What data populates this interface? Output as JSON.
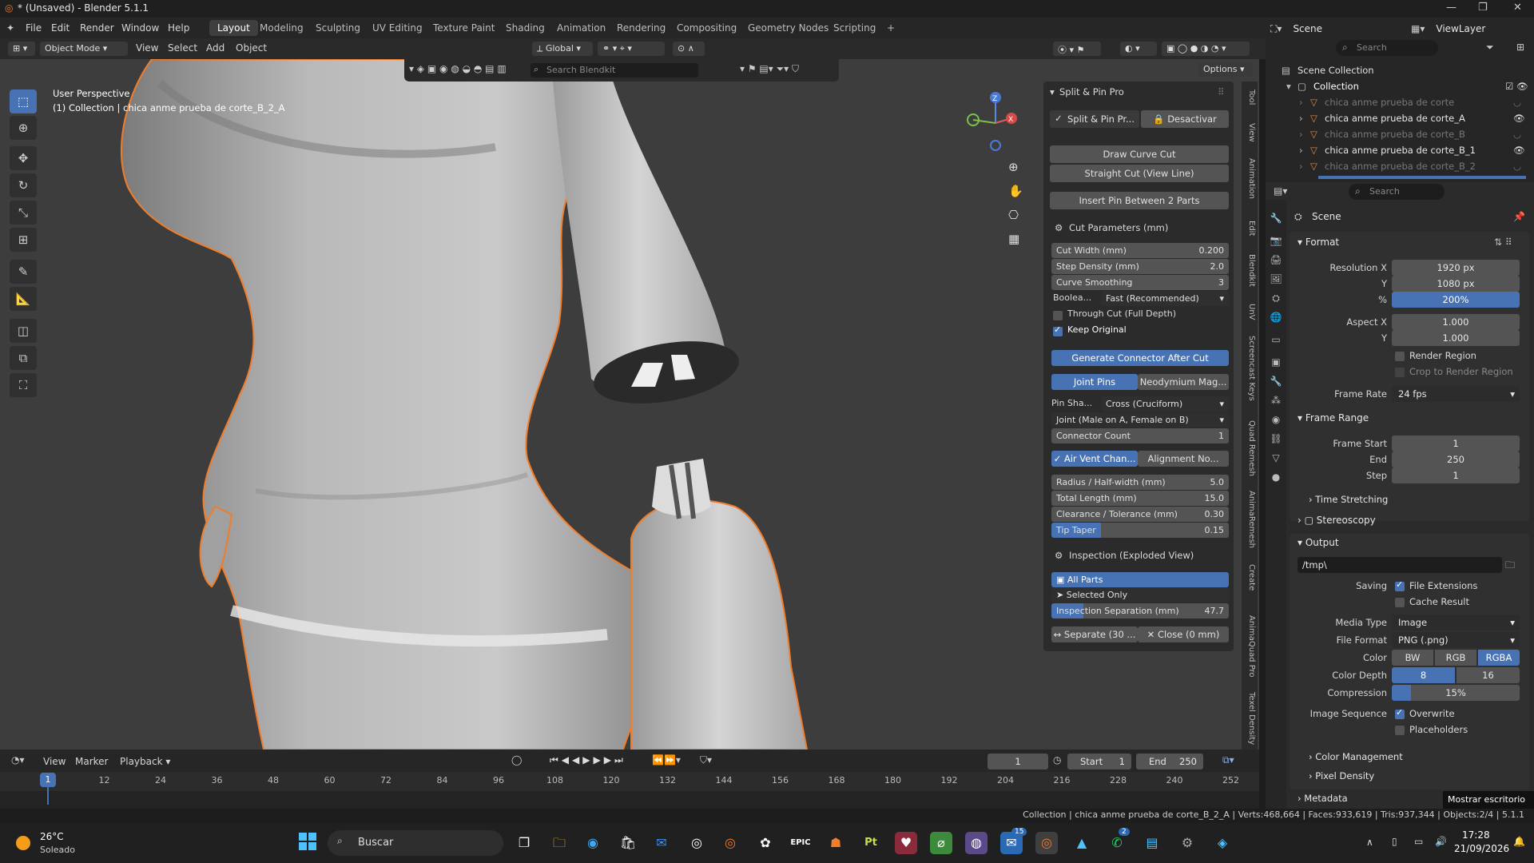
{
  "window": {
    "title": "* (Unsaved) - Blender 5.1.1",
    "controls": [
      "—",
      "❐",
      "✕"
    ]
  },
  "menu": [
    "File",
    "Edit",
    "Render",
    "Window",
    "Help"
  ],
  "workspaces": [
    "Layout",
    "Modeling",
    "Sculpting",
    "UV Editing",
    "Texture Paint",
    "Shading",
    "Animation",
    "Rendering",
    "Compositing",
    "Geometry Nodes",
    "Scripting",
    "+"
  ],
  "active_workspace": "Layout",
  "scene": {
    "label": "Scene",
    "view_layer": "ViewLayer"
  },
  "header": {
    "mode": "Object Mode",
    "view": "View",
    "select": "Select",
    "add": "Add",
    "object": "Object",
    "orientation": "Global",
    "options": "Options"
  },
  "blendkit": {
    "search_placeholder": "Search Blendkit"
  },
  "viewport": {
    "perspective": "User Perspective",
    "collection_line": "(1) Collection | chica anme prueba de corte_B_2_A"
  },
  "split_pin": {
    "title": "Split & Pin Pro",
    "addon_label": "Split & Pin Pr...",
    "deactivate": "Desactivar",
    "draw_curve_cut": "Draw Curve Cut",
    "straight_cut": "Straight Cut (View Line)",
    "insert_pin": "Insert Pin Between 2 Parts",
    "cut_params": "Cut Parameters (mm)",
    "cut_width": {
      "label": "Cut Width (mm)",
      "value": "0.200"
    },
    "step_density": {
      "label": "Step Density (mm)",
      "value": "2.0"
    },
    "curve_smoothing": {
      "label": "Curve Smoothing",
      "value": "3"
    },
    "boolean": {
      "label": "Boolea...",
      "value": "Fast (Recommended)"
    },
    "through_cut": "Through Cut (Full Depth)",
    "keep_original": "Keep Original",
    "generate_connector": "Generate Connector After Cut",
    "joint_pins": "Joint Pins",
    "neodymium": "Neodymium Mag...",
    "pin_shape": {
      "label": "Pin Sha...",
      "value": "Cross (Cruciform)"
    },
    "joint_type": "Joint (Male on A, Female on B)",
    "connector_count": {
      "label": "Connector Count",
      "value": "1"
    },
    "air_vent": "Air Vent Chan...",
    "alignment": "Alignment No...",
    "radius": {
      "label": "Radius / Half-width (mm)",
      "value": "5.0"
    },
    "total_length": {
      "label": "Total Length (mm)",
      "value": "15.0"
    },
    "clearance": {
      "label": "Clearance / Tolerance (mm)",
      "value": "0.30"
    },
    "tip_taper": {
      "label": "Tip Taper",
      "value": "0.15"
    },
    "inspection": "Inspection (Exploded View)",
    "all_parts": "All Parts",
    "selected_only": "Selected Only",
    "inspection_sep": {
      "label": "Inspection Separation (mm)",
      "value": "47.7"
    },
    "separate": "Separate (30 ...",
    "close": "Close (0 mm)"
  },
  "side_tabs": [
    "Tool",
    "View",
    "Animation",
    "Edit",
    "Blendkit",
    "UnV",
    "Screencast Keys",
    "Quad Remesh",
    "AnimaRemesh",
    "Create",
    "AnimaQuad Pro",
    "Texel Density"
  ],
  "outliner": {
    "search_placeholder": "Search",
    "scene_collection": "Scene Collection",
    "collection": "Collection",
    "items": [
      {
        "name": "chica anme prueba de corte",
        "dim": true
      },
      {
        "name": "chica anme prueba de corte_A",
        "dim": false
      },
      {
        "name": "chica anme prueba de corte_B",
        "dim": true
      },
      {
        "name": "chica anme prueba de corte_B_1",
        "dim": false
      },
      {
        "name": "chica anme prueba de corte_B_2",
        "dim": true
      }
    ]
  },
  "properties": {
    "search_placeholder": "Search",
    "context": "Scene",
    "format": "Format",
    "res_x": {
      "label": "Resolution X",
      "value": "1920 px"
    },
    "res_y": {
      "label": "Y",
      "value": "1080 px"
    },
    "res_pct": {
      "label": "%",
      "value": "200%"
    },
    "aspect_x": {
      "label": "Aspect X",
      "value": "1.000"
    },
    "aspect_y": {
      "label": "Y",
      "value": "1.000"
    },
    "render_region": "Render Region",
    "crop": "Crop to Render Region",
    "frame_rate": {
      "label": "Frame Rate",
      "value": "24 fps"
    },
    "frame_range": "Frame Range",
    "frame_start": {
      "label": "Frame Start",
      "value": "1"
    },
    "frame_end": {
      "label": "End",
      "value": "250"
    },
    "frame_step": {
      "label": "Step",
      "value": "1"
    },
    "time_stretching": "Time Stretching",
    "stereoscopy": "Stereoscopy",
    "output": "Output",
    "path": "/tmp\\",
    "saving": "Saving",
    "file_ext": "File Extensions",
    "cache_result": "Cache Result",
    "media_type": {
      "label": "Media Type",
      "value": "Image"
    },
    "file_format": {
      "label": "File Format",
      "value": "PNG (.png)"
    },
    "color": {
      "label": "Color",
      "options": [
        "BW",
        "RGB",
        "RGBA"
      ]
    },
    "color_depth": {
      "label": "Color Depth",
      "options": [
        "8",
        "16"
      ]
    },
    "compression": {
      "label": "Compression",
      "value": "15%"
    },
    "image_sequence": "Image Sequence",
    "overwrite": "Overwrite",
    "placeholders": "Placeholders",
    "color_mgmt": "Color Management",
    "pixel_density": "Pixel Density",
    "metadata": "Metadata",
    "show_desktop": "Mostrar escritorio"
  },
  "timeline": {
    "view": "View",
    "marker": "Marker",
    "playback": "Playback",
    "current_frame": "1",
    "start_label": "Start",
    "start": "1",
    "end_label": "End",
    "end": "250",
    "ticks": [
      "1",
      "12",
      "24",
      "36",
      "48",
      "60",
      "72",
      "84",
      "96",
      "108",
      "120",
      "132",
      "144",
      "156",
      "168",
      "180",
      "192",
      "204",
      "216",
      "228",
      "240",
      "252"
    ]
  },
  "status": "Collection | chica anme prueba de corte_B_2_A | Verts:468,664 | Faces:933,619 | Tris:937,344 | Objects:2/4 | 5.1.1",
  "taskbar": {
    "weather_temp": "26°C",
    "weather_text": "Soleado",
    "search": "Buscar",
    "time": "17:28",
    "date": "21/09/2026",
    "badge1": "15",
    "badge2": "2"
  }
}
